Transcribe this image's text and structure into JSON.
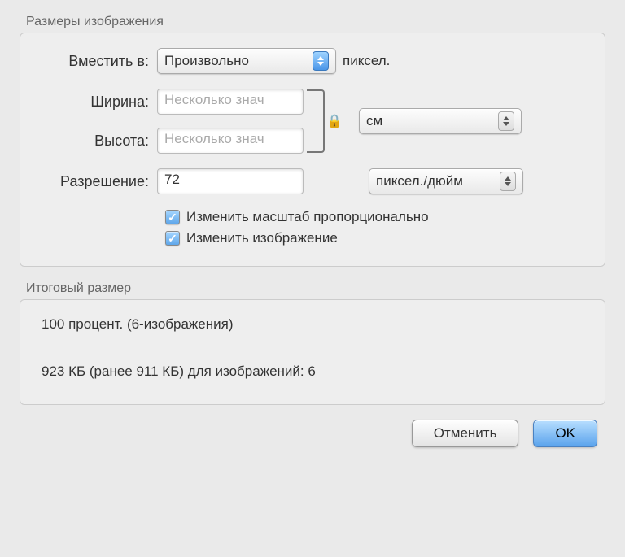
{
  "groups": {
    "dimensions_title": "Размеры изображения",
    "summary_title": "Итоговый размер"
  },
  "fit": {
    "label": "Вместить в:",
    "value": "Произвольно",
    "unit": "пиксел."
  },
  "width": {
    "label": "Ширина:",
    "placeholder": "Несколько знач"
  },
  "height": {
    "label": "Высота:",
    "placeholder": "Несколько знач"
  },
  "dims_unit": {
    "value": "см"
  },
  "resolution": {
    "label": "Разрешение:",
    "value": "72",
    "unit": "пиксел./дюйм"
  },
  "checkboxes": {
    "scale_label": "Изменить масштаб пропорционально",
    "resize_label": "Изменить изображение"
  },
  "summary": {
    "line1": "100 процент. (6-изображения)",
    "line2": "923 КБ (ранее 911 КБ) для изображений: 6"
  },
  "buttons": {
    "cancel": "Отменить",
    "ok": "OK"
  }
}
